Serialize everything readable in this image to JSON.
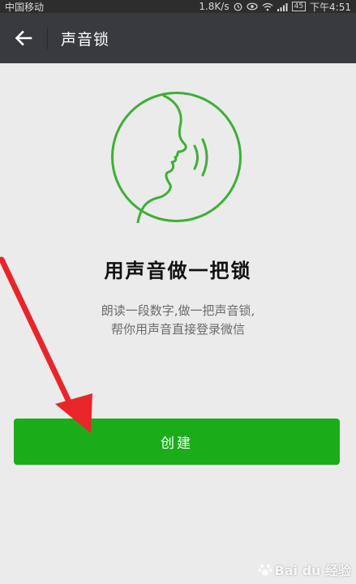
{
  "status_bar": {
    "carrier": "中国移动",
    "speed": "1.8K/s",
    "battery": "45",
    "time": "下午4:51"
  },
  "app_bar": {
    "title": "声音锁",
    "back_icon": "arrow-left-icon"
  },
  "content": {
    "illustration_icon": "voice-face-icon",
    "heading": "用声音做一把锁",
    "description_line1": "朗读一段数字,做一把声音锁,",
    "description_line2": "帮你用声音直接登录微信",
    "create_button": "创建"
  },
  "watermark": {
    "text": "Bai du 经验"
  },
  "colors": {
    "status_bar_bg": "#2d2d2d",
    "app_bar_bg": "#393a3f",
    "page_bg": "#ebebeb",
    "accent_green": "#1aad19",
    "illustration_green": "#3cb034",
    "arrow_red": "#e8262a"
  }
}
